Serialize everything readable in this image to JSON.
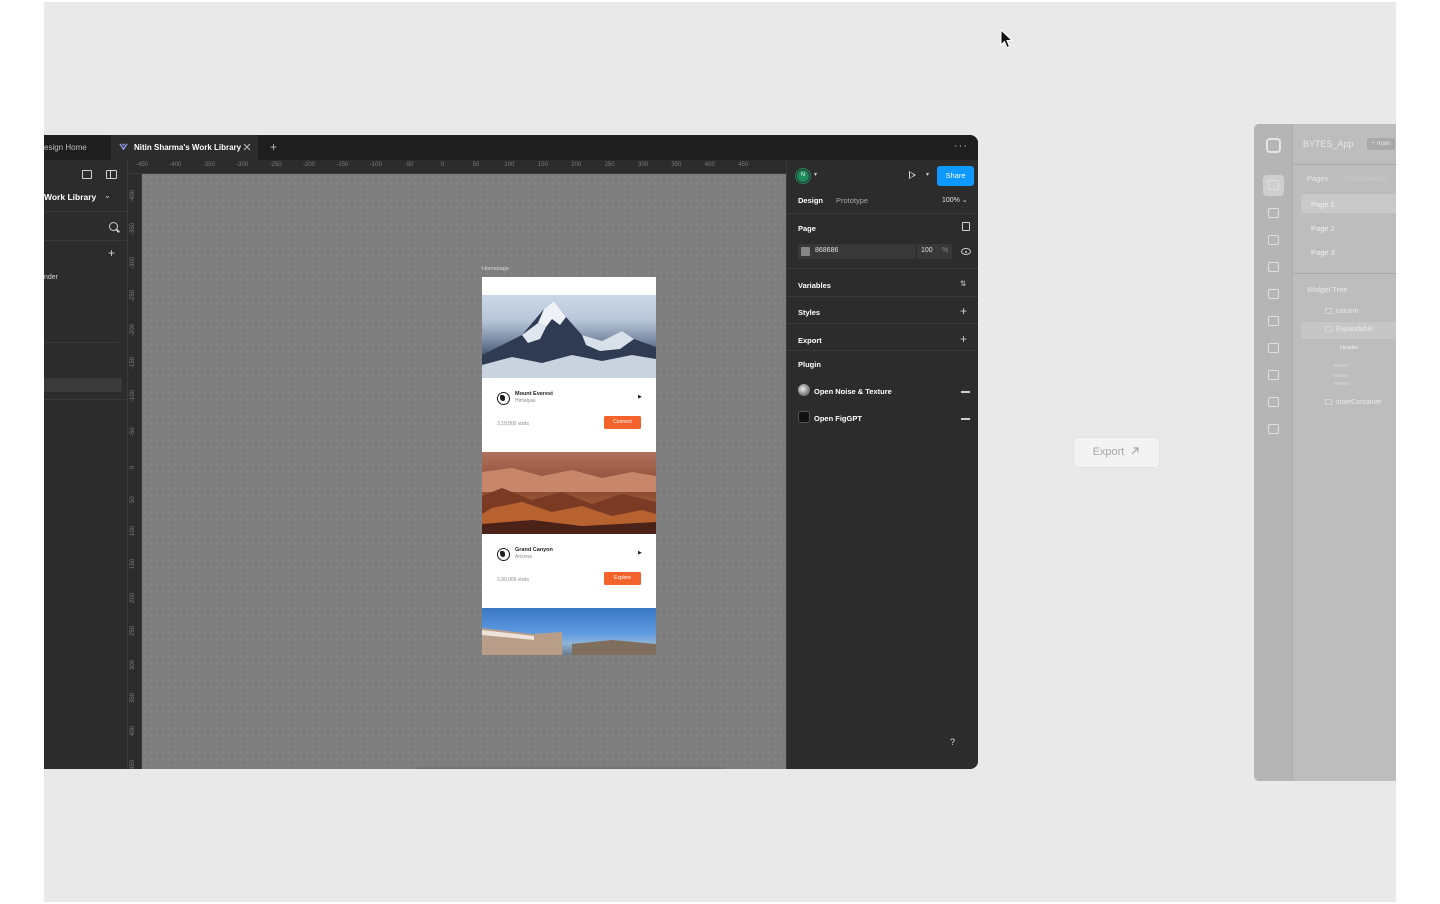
{
  "figma": {
    "tabs": {
      "home_label": "esign Home",
      "library_label": "Nitin Sharma's Work Library"
    },
    "left_panel": {
      "file_title": "Work Library",
      "page_item": "nder"
    },
    "ruler_top": [
      "-450",
      "-400",
      "-350",
      "-300",
      "-250",
      "-200",
      "-150",
      "-100",
      "-50",
      "0",
      "50",
      "100",
      "150",
      "200",
      "250",
      "300",
      "350",
      "400",
      "450"
    ],
    "ruler_left": [
      "-400",
      "-350",
      "-300",
      "-250",
      "-200",
      "-150",
      "-100",
      "-50",
      "0",
      "50",
      "100",
      "150",
      "200",
      "250",
      "300",
      "350",
      "400",
      "450"
    ],
    "canvas": {
      "frame_label": "Homepage",
      "cards": [
        {
          "title": "Mount Everest",
          "subtitle": "Himalyas",
          "visits": "3,19,800 visits",
          "button": "Connect"
        },
        {
          "title": "Grand Canyon",
          "subtitle": "Arizona",
          "visits": "2,90,000 visits",
          "button": "Explore"
        }
      ]
    },
    "right_panel": {
      "avatar_initial": "N",
      "share_label": "Share",
      "tab_design": "Design",
      "tab_prototype": "Prototype",
      "zoom": "100%",
      "page_heading": "Page",
      "page_color_hex": "868686",
      "page_color": "#868686",
      "page_opacity": "100",
      "page_opacity_unit": "%",
      "variables_heading": "Variables",
      "styles_heading": "Styles",
      "export_heading": "Export",
      "plugin_heading": "Plugin",
      "plugins": [
        "Open Noise & Texture",
        "Open FigGPT"
      ],
      "help": "?"
    },
    "accent_color": "#0d99ff"
  },
  "export_button": {
    "label": "Export",
    "icon": "arrow-up-right-icon"
  },
  "flutterflow": {
    "project_title": "BYTES_App",
    "branch": "main",
    "tab_pages": "Pages",
    "tab_components": "Components",
    "pages": [
      "Page 1",
      "Page 2",
      "Page 3"
    ],
    "widget_tree_title": "Widget Tree",
    "nodes": {
      "column": "column",
      "expandable": "Expandable",
      "header": "Header",
      "state_container": "stateContainer"
    }
  },
  "cta_color": "#f2622a"
}
